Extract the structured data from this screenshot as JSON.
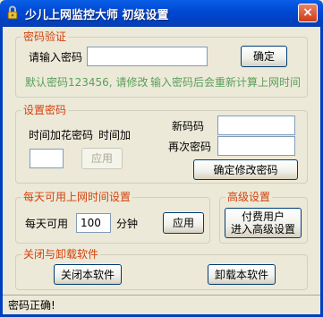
{
  "window": {
    "title": "少儿上网监控大师  初级设置",
    "close_label": "×"
  },
  "password_verify": {
    "legend": "密码验证",
    "prompt_label": "请输入密码",
    "input_value": "",
    "confirm_label": "确定",
    "hint_default": "默认密码123456, 请修改",
    "hint_recalc": "输入密码后会重新计算上网时间"
  },
  "password_set": {
    "legend": "设置密码",
    "time_add_label": "时间加花密码",
    "time_add_label2": "时间加",
    "time_add_value": "",
    "apply_label": "应用",
    "new_password_label": "新码码",
    "new_password_value": "",
    "repeat_password_label": "再次密码",
    "repeat_password_value": "",
    "confirm_change_label": "确定修改密码"
  },
  "daily_time": {
    "legend": "每天可用上网时间设置",
    "prefix_label": "每天可用",
    "minutes_value": "100",
    "unit_label": "分钟",
    "apply_label": "应用"
  },
  "advanced": {
    "legend": "高级设置",
    "button_line1": "付费用户",
    "button_line2": "进入高级设置"
  },
  "close_uninstall": {
    "legend": "关闭与卸载软件",
    "close_label": "关闭本软件",
    "uninstall_label": "卸载本软件"
  },
  "status": {
    "text": "密码正确!"
  }
}
